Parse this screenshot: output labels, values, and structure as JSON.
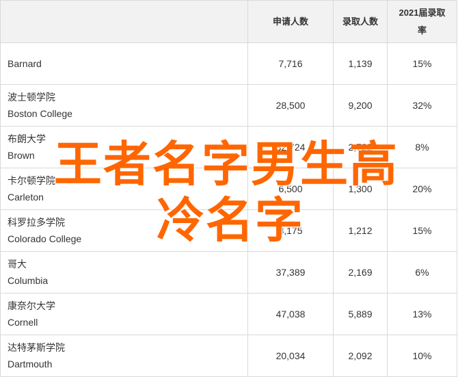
{
  "table": {
    "headers": [
      "",
      "申请人数",
      "录取人数",
      "2021届录取率"
    ],
    "rows": [
      {
        "cn": "",
        "en": "Barnard",
        "applicants": "7,716",
        "admitted": "1,139",
        "rate": "15%"
      },
      {
        "cn": "波士顿学院",
        "en": "Boston College",
        "applicants": "28,500",
        "admitted": "9,200",
        "rate": "32%"
      },
      {
        "cn": "布朗大学",
        "en": "Brown",
        "applicants": "32,724",
        "admitted": "2,722",
        "rate": "8%"
      },
      {
        "cn": "卡尔顿学院",
        "en": "Carleton",
        "applicants": "6,500",
        "admitted": "1,300",
        "rate": "20%"
      },
      {
        "cn": "科罗拉多学院",
        "en": "Colorado College",
        "applicants": "8,175",
        "admitted": "1,212",
        "rate": "15%"
      },
      {
        "cn": "哥大",
        "en": "Columbia",
        "applicants": "37,389",
        "admitted": "2,169",
        "rate": "6%"
      },
      {
        "cn": "康奈尔大学",
        "en": "Cornell",
        "applicants": "47,038",
        "admitted": "5,889",
        "rate": "13%"
      },
      {
        "cn": "达特茅斯学院",
        "en": "Dartmouth",
        "applicants": "20,034",
        "admitted": "2,092",
        "rate": "10%"
      }
    ]
  },
  "watermark": {
    "line1": "王者名字男生高",
    "line2": "冷名字",
    "color": "#ff6600"
  }
}
